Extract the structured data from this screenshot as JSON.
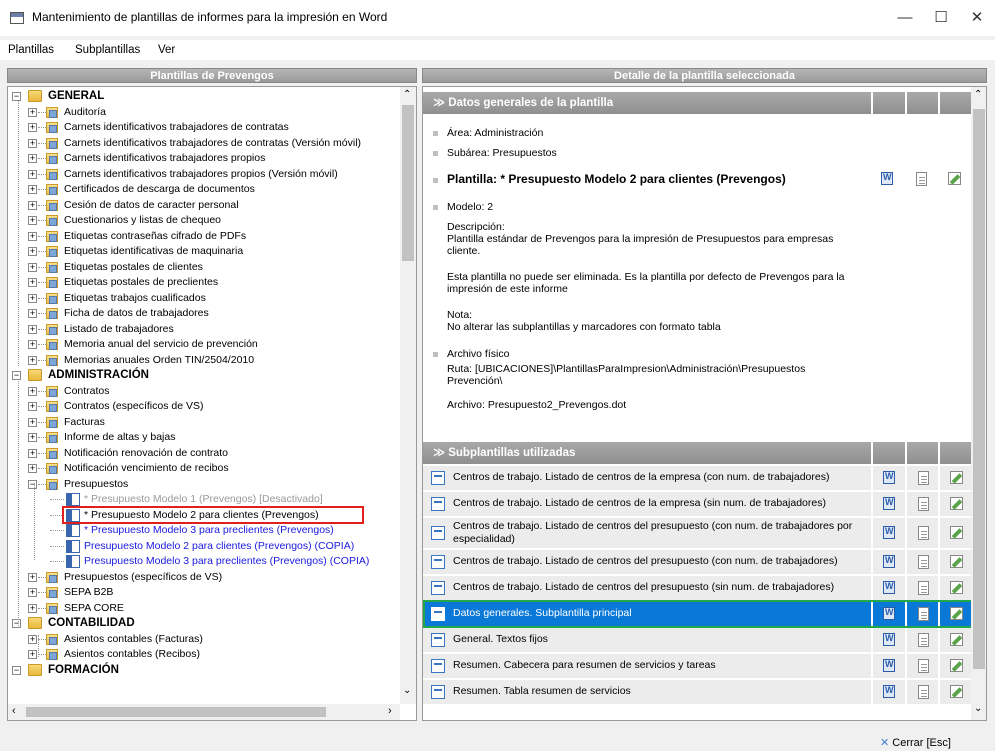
{
  "window": {
    "title": "Mantenimiento de plantillas de informes para la impresión en Word",
    "minimize": "—",
    "maximize": "☐",
    "close": "✕"
  },
  "menu": [
    "Plantillas",
    "Subplantillas",
    "Ver"
  ],
  "left_panel": {
    "title": "Plantillas de Prevengos"
  },
  "right_panel": {
    "title": "Detalle de la plantilla seleccionada"
  },
  "tree": [
    {
      "label": "GENERAL",
      "level": 0,
      "kind": "group",
      "expander": "−"
    },
    {
      "label": "Auditoría",
      "level": 1,
      "kind": "folder",
      "expander": "+"
    },
    {
      "label": "Carnets identificativos trabajadores de contratas",
      "level": 1,
      "kind": "folder",
      "expander": "+"
    },
    {
      "label": "Carnets identificativos trabajadores de contratas (Versión móvil)",
      "level": 1,
      "kind": "folder",
      "expander": "+"
    },
    {
      "label": "Carnets identificativos trabajadores propios",
      "level": 1,
      "kind": "folder",
      "expander": "+"
    },
    {
      "label": "Carnets identificativos trabajadores propios (Versión móvil)",
      "level": 1,
      "kind": "folder",
      "expander": "+"
    },
    {
      "label": "Certificados de descarga de documentos",
      "level": 1,
      "kind": "folder",
      "expander": "+"
    },
    {
      "label": "Cesión de datos de caracter personal",
      "level": 1,
      "kind": "folder",
      "expander": "+"
    },
    {
      "label": "Cuestionarios y listas de chequeo",
      "level": 1,
      "kind": "folder",
      "expander": "+"
    },
    {
      "label": "Etiquetas contraseñas cifrado de PDFs",
      "level": 1,
      "kind": "folder",
      "expander": "+"
    },
    {
      "label": "Etiquetas identificativas de maquinaria",
      "level": 1,
      "kind": "folder",
      "expander": "+"
    },
    {
      "label": "Etiquetas postales de clientes",
      "level": 1,
      "kind": "folder",
      "expander": "+"
    },
    {
      "label": "Etiquetas postales de preclientes",
      "level": 1,
      "kind": "folder",
      "expander": "+"
    },
    {
      "label": "Etiquetas trabajos cualificados",
      "level": 1,
      "kind": "folder",
      "expander": "+"
    },
    {
      "label": "Ficha de datos de trabajadores",
      "level": 1,
      "kind": "folder",
      "expander": "+"
    },
    {
      "label": "Listado de trabajadores",
      "level": 1,
      "kind": "folder",
      "expander": "+"
    },
    {
      "label": "Memoria anual del servicio de prevención",
      "level": 1,
      "kind": "folder",
      "expander": "+"
    },
    {
      "label": "Memorias anuales Orden TIN/2504/2010",
      "level": 1,
      "kind": "folder",
      "expander": "+"
    },
    {
      "label": "ADMINISTRACIÓN",
      "level": 0,
      "kind": "group",
      "expander": "−"
    },
    {
      "label": "Contratos",
      "level": 1,
      "kind": "folder",
      "expander": "+"
    },
    {
      "label": "Contratos (específicos de VS)",
      "level": 1,
      "kind": "folder",
      "expander": "+"
    },
    {
      "label": "Facturas",
      "level": 1,
      "kind": "folder",
      "expander": "+"
    },
    {
      "label": "Informe de altas y bajas",
      "level": 1,
      "kind": "folder",
      "expander": "+"
    },
    {
      "label": "Notificación renovación de contrato",
      "level": 1,
      "kind": "folder",
      "expander": "+"
    },
    {
      "label": "Notificación vencimiento de recibos",
      "level": 1,
      "kind": "folder",
      "expander": "+"
    },
    {
      "label": "Presupuestos",
      "level": 1,
      "kind": "folder",
      "expander": "−"
    },
    {
      "label": "* Presupuesto Modelo 1 (Prevengos)  [Desactivado]",
      "level": 2,
      "kind": "doc",
      "color": "#9a9a9a"
    },
    {
      "label": "* Presupuesto Modelo 2 para clientes (Prevengos)",
      "level": 2,
      "kind": "doc",
      "color": "#000000",
      "selected": true
    },
    {
      "label": "* Presupuesto Modelo 3 para preclientes (Prevengos)",
      "level": 2,
      "kind": "doc",
      "color": "#1a1ae0"
    },
    {
      "label": "Presupuesto Modelo 2 para clientes (Prevengos) (COPIA)",
      "level": 2,
      "kind": "doc",
      "color": "#1a1ae0"
    },
    {
      "label": "Presupuesto Modelo 3 para preclientes (Prevengos) (COPIA)",
      "level": 2,
      "kind": "doc",
      "color": "#1a1ae0"
    },
    {
      "label": "Presupuestos (específicos de VS)",
      "level": 1,
      "kind": "folder",
      "expander": "+"
    },
    {
      "label": "SEPA B2B",
      "level": 1,
      "kind": "folder",
      "expander": "+"
    },
    {
      "label": "SEPA CORE",
      "level": 1,
      "kind": "folder",
      "expander": "+"
    },
    {
      "label": "CONTABILIDAD",
      "level": 0,
      "kind": "group",
      "expander": "−"
    },
    {
      "label": "Asientos contables (Facturas)",
      "level": 1,
      "kind": "folder",
      "expander": "+"
    },
    {
      "label": "Asientos contables (Recibos)",
      "level": 1,
      "kind": "folder",
      "expander": "+"
    },
    {
      "label": "FORMACIÓN",
      "level": 0,
      "kind": "group",
      "expander": "−"
    }
  ],
  "general": {
    "section_title": "Datos generales de la plantilla",
    "area": "Área: Administración",
    "subarea": "Subárea: Presupuestos",
    "plantilla": "Plantilla: * Presupuesto Modelo 2 para clientes (Prevengos)",
    "modelo": "Modelo: 2",
    "descripcion_label": "Descripción:",
    "descripcion_1": "Plantilla estándar de Prevengos para la impresión de Presupuestos para empresas",
    "descripcion_2": "cliente.",
    "nota_borrar_1": "Esta plantilla no puede ser eliminada. Es la plantilla por defecto de Prevengos para la",
    "nota_borrar_2": "impresión de este informe",
    "nota_label": "Nota:",
    "nota": "No alterar las subplantillas y marcadores con formato tabla",
    "archivo_fisico": "Archivo físico",
    "ruta_1": "Ruta: [UBICACIONES]\\PlantillasParaImpresion\\Administración\\Presupuestos",
    "ruta_2": "Prevención\\",
    "archivo": "Archivo: Presupuesto2_Prevengos.dot"
  },
  "sub": {
    "section_title": "Subplantillas utilizadas",
    "rows": [
      {
        "label": "Centros de trabajo. Listado de centros de la empresa (con num. de trabajadores)"
      },
      {
        "label": "Centros de trabajo. Listado de centros de la empresa (sin num. de trabajadores)"
      },
      {
        "label": " Centros de trabajo. Listado de centros del presupuesto (con num. de trabajadores por",
        "label2": "especialidad)",
        "tall": true
      },
      {
        "label": "Centros de trabajo. Listado de centros del presupuesto (con num. de trabajadores)"
      },
      {
        "label": "Centros de trabajo. Listado de centros del presupuesto (sin num. de trabajadores)"
      },
      {
        "label": "Datos generales. Subplantilla principal",
        "selected": true
      },
      {
        "label": "General. Textos fijos"
      },
      {
        "label": "Resumen. Cabecera para resumen de servicios y tareas"
      },
      {
        "label": "Resumen. Tabla resumen de servicios"
      }
    ]
  },
  "footer": {
    "close_label": "Cerrar [Esc]",
    "close_icon": "✕"
  },
  "colors": {
    "selection_blue": "#0a78d7",
    "highlight_red": "#e0201c",
    "highlight_green": "#22a84a"
  }
}
